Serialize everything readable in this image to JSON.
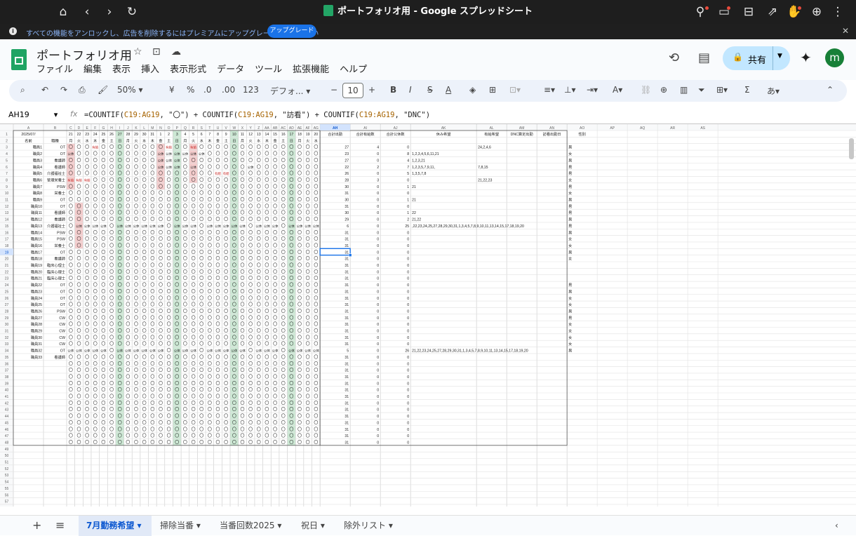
{
  "window": {
    "title": "ポートフォリオ用 - Google スプレッドシート"
  },
  "banner": {
    "message": "すべての機能をアンロックし、広告を削除するにはプレミアムにアップグレードしてください",
    "upgrade": "アップグレード"
  },
  "doc": {
    "title": "ポートフォリオ用",
    "menu": [
      "ファイル",
      "編集",
      "表示",
      "挿入",
      "表示形式",
      "データ",
      "ツール",
      "拡張機能",
      "ヘルプ"
    ],
    "share": "共有",
    "avatar": "m"
  },
  "toolbar": {
    "zoom": "50%",
    "currency": "¥",
    "percent": "%",
    "dec_down": ".0",
    "dec_up": ".00",
    "num_format": "123",
    "font": "デフォ...",
    "font_size": "10"
  },
  "formula_bar": {
    "name_box": "AH19",
    "fx": "fx",
    "formula": "=COUNTIF(C19:AG19, \"〇\") + COUNTIF(C19:AG19, \"訪看\") + COUNTIF(C19:AG19, \"DNC\")"
  },
  "sheet": {
    "col_letters": [
      "A",
      "B",
      "C",
      "D",
      "E",
      "F",
      "G",
      "H",
      "I",
      "J",
      "K",
      "L",
      "M",
      "N",
      "O",
      "P",
      "Q",
      "R",
      "S",
      "T",
      "U",
      "V",
      "W",
      "X",
      "Y",
      "Z",
      "AA",
      "AB",
      "AC",
      "AD",
      "AE",
      "AF",
      "AG",
      "AH",
      "AI",
      "AJ",
      "AK",
      "AL",
      "AM",
      "AN",
      "AO",
      "AP",
      "AQ",
      "AR",
      "AS"
    ],
    "month": "2025/07/",
    "days": [
      "21",
      "22",
      "23",
      "24",
      "25",
      "26",
      "27",
      "28",
      "29",
      "30",
      "31",
      "1",
      "2",
      "3",
      "4",
      "5",
      "6",
      "7",
      "8",
      "9",
      "10",
      "11",
      "12",
      "13",
      "14",
      "15",
      "16",
      "17",
      "18",
      "19",
      "20"
    ],
    "weekdays": [
      "月",
      "火",
      "水",
      "木",
      "金",
      "土",
      "日",
      "月",
      "火",
      "水",
      "木",
      "金",
      "土",
      "日",
      "月",
      "火",
      "水",
      "木",
      "金",
      "土",
      "日",
      "月",
      "火",
      "水",
      "木",
      "金",
      "土",
      "日",
      "月",
      "火",
      "水"
    ],
    "header_row2": {
      "name": "名前",
      "job": "職種"
    },
    "header_row1": {
      "total_work": "合計出勤",
      "total_paid": "合計有給数",
      "total_holiday": "合計公休数",
      "rest_wish": "休み希望",
      "paid_wish": "有給希望",
      "dnc": "DNC算定出勤",
      "visit": "訪看出勤日",
      "gender": "性別"
    },
    "staff": [
      {
        "name": "職員1",
        "job": "OT",
        "work": "27",
        "paid": "4",
        "hol": "0",
        "rest": "",
        "pw": "24,2,4,6",
        "g": "男"
      },
      {
        "name": "職員2",
        "job": "OT",
        "work": "23",
        "paid": "0",
        "hol": "8",
        "rest": "1,2,3,4,5,6,11,21",
        "pw": "",
        "g": "女"
      },
      {
        "name": "職員3",
        "job": "看護師",
        "work": "27",
        "paid": "0",
        "hol": "4",
        "rest": "1,2,3,21",
        "pw": "",
        "g": "男"
      },
      {
        "name": "職員4",
        "job": "看護師",
        "work": "22",
        "paid": "2",
        "hol": "7",
        "rest": "1,2,3,5,7,9,11,",
        "pw": "7,8,15",
        "g": "男"
      },
      {
        "name": "職員5",
        "job": "介護福祉士",
        "work": "26",
        "paid": "0",
        "hol": "5",
        "rest": "1,3,5,7,8",
        "pw": "",
        "g": "男"
      },
      {
        "name": "職員6",
        "job": "管理栄養士",
        "work": "28",
        "paid": "3",
        "hol": "0",
        "rest": "",
        "pw": "21,22,23",
        "g": "女"
      },
      {
        "name": "職員7",
        "job": "PSW",
        "work": "30",
        "paid": "0",
        "hol": "1",
        "rest": "21",
        "pw": "",
        "g": "男"
      },
      {
        "name": "職員8",
        "job": "栄養士",
        "work": "31",
        "paid": "0",
        "hol": "0",
        "rest": "",
        "pw": "",
        "g": "女"
      },
      {
        "name": "職員9",
        "job": "OT",
        "work": "30",
        "paid": "0",
        "hol": "1",
        "rest": "21",
        "pw": "",
        "g": "男"
      },
      {
        "name": "職員10",
        "job": "OT",
        "work": "31",
        "paid": "0",
        "hol": "0",
        "rest": "",
        "pw": "",
        "g": "男"
      },
      {
        "name": "職員11",
        "job": "看護師",
        "work": "30",
        "paid": "0",
        "hol": "1",
        "rest": "22",
        "pw": "",
        "g": "男"
      },
      {
        "name": "職員12",
        "job": "看護師",
        "work": "29",
        "paid": "0",
        "hol": "2",
        "rest": "21,22",
        "pw": "",
        "g": "男"
      },
      {
        "name": "職員13",
        "job": "介護福祉士",
        "work": "6",
        "paid": "0",
        "hol": "25",
        "rest": ",22,23,24,25,27,28,29,30,31,1,3,4,5,7,8,9,10,11,13,14,15,17,18,19,20",
        "pw": "",
        "g": "男"
      },
      {
        "name": "職員14",
        "job": "PSW",
        "work": "31",
        "paid": "0",
        "hol": "0",
        "rest": "",
        "pw": "",
        "g": "男"
      },
      {
        "name": "職員15",
        "job": "PSW",
        "work": "31",
        "paid": "0",
        "hol": "0",
        "rest": "",
        "pw": "",
        "g": "女"
      },
      {
        "name": "職員16",
        "job": "栄養士",
        "work": "31",
        "paid": "0",
        "hol": "0",
        "rest": "",
        "pw": "",
        "g": "女"
      },
      {
        "name": "職員17",
        "job": "OT",
        "work": "31",
        "paid": "0",
        "hol": "0",
        "rest": "",
        "pw": "",
        "g": "男"
      },
      {
        "name": "職員18",
        "job": "看護師",
        "work": "31",
        "paid": "0",
        "hol": "0",
        "rest": "",
        "pw": "",
        "g": "女"
      },
      {
        "name": "職員19",
        "job": "臨床心理士",
        "work": "31",
        "paid": "0",
        "hol": "0",
        "rest": "",
        "pw": "",
        "g": ""
      },
      {
        "name": "職員20",
        "job": "臨床心理士",
        "work": "31",
        "paid": "0",
        "hol": "0",
        "rest": "",
        "pw": "",
        "g": ""
      },
      {
        "name": "職員21",
        "job": "臨床心理士",
        "work": "31",
        "paid": "0",
        "hol": "0",
        "rest": "",
        "pw": "",
        "g": ""
      },
      {
        "name": "職員22",
        "job": "OT",
        "work": "31",
        "paid": "0",
        "hol": "0",
        "rest": "",
        "pw": "",
        "g": "男"
      },
      {
        "name": "職員23",
        "job": "OT",
        "work": "31",
        "paid": "0",
        "hol": "0",
        "rest": "",
        "pw": "",
        "g": "男"
      },
      {
        "name": "職員24",
        "job": "OT",
        "work": "31",
        "paid": "0",
        "hol": "0",
        "rest": "",
        "pw": "",
        "g": "女"
      },
      {
        "name": "職員25",
        "job": "OT",
        "work": "31",
        "paid": "0",
        "hol": "0",
        "rest": "",
        "pw": "",
        "g": "女"
      },
      {
        "name": "職員26",
        "job": "PSW",
        "work": "31",
        "paid": "0",
        "hol": "0",
        "rest": "",
        "pw": "",
        "g": "男"
      },
      {
        "name": "職員27",
        "job": "CW",
        "work": "31",
        "paid": "0",
        "hol": "0",
        "rest": "",
        "pw": "",
        "g": "男"
      },
      {
        "name": "職員28",
        "job": "CW",
        "work": "31",
        "paid": "0",
        "hol": "0",
        "rest": "",
        "pw": "",
        "g": "女"
      },
      {
        "name": "職員29",
        "job": "CW",
        "work": "31",
        "paid": "0",
        "hol": "0",
        "rest": "",
        "pw": "",
        "g": "女"
      },
      {
        "name": "職員30",
        "job": "CW",
        "work": "31",
        "paid": "0",
        "hol": "0",
        "rest": "",
        "pw": "",
        "g": "女"
      },
      {
        "name": "職員31",
        "job": "CW",
        "work": "31",
        "paid": "0",
        "hol": "0",
        "rest": "",
        "pw": "",
        "g": "女"
      },
      {
        "name": "職員32",
        "job": "OT",
        "work": "5",
        "paid": "0",
        "hol": "26",
        "rest": "21,22,23,24,25,27,28,29,30,31,1,3,4,5,7,8,9,10,11,13,14,15,17,18,19,20",
        "pw": "",
        "g": "男"
      },
      {
        "name": "職員33",
        "job": "看護師",
        "work": "31",
        "paid": "0",
        "hol": "0",
        "rest": "",
        "pw": "",
        "g": ""
      }
    ],
    "blank_work_value": "31",
    "symbols": {
      "work": "〇",
      "paid": "有給",
      "holiday": "公休"
    },
    "selected_cell": "AH19",
    "colors": {
      "sunday": "#cce8d4",
      "paid": "#f4cccc",
      "holiday_pink": "#f4cccc",
      "selection": "#1a73e8"
    }
  },
  "tabs": {
    "add": "+",
    "list": "≡",
    "items": [
      "7月勤務希望",
      "掃除当番",
      "当番回数2025",
      "祝日",
      "除外リスト"
    ],
    "active": 0
  }
}
